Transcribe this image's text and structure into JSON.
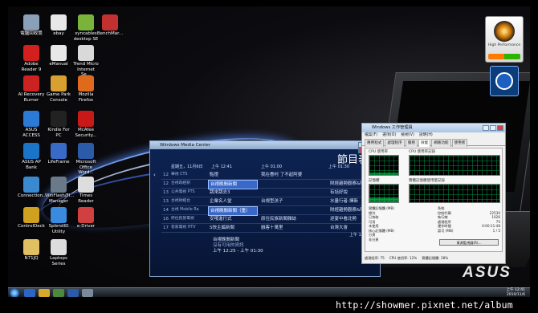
{
  "desktop_icons": [
    {
      "label": "電腦回收筒",
      "color": "#8aa0b8"
    },
    {
      "label": "ebay",
      "color": "#e8e8e8"
    },
    {
      "label": "syncables desktop SE",
      "color": "#7ab33a"
    },
    {
      "label": "BenchMar...",
      "color": "#c23030"
    },
    {
      "label": "Adobe Reader 9",
      "color": "#d41f1f"
    },
    {
      "label": "eManual",
      "color": "#e8e8e8"
    },
    {
      "label": "Trend Micro Internet Se...",
      "color": "#d9d9d9"
    },
    {
      "label": "AI Recovery Burner",
      "color": "#c22"
    },
    {
      "label": "Game Park Console",
      "color": "#d8a030"
    },
    {
      "label": "Mozilla Firefox",
      "color": "#e06a1c"
    },
    {
      "label": "ASUS ACCESS",
      "color": "#2a7ad6"
    },
    {
      "label": "Kindle For PC",
      "color": "#222"
    },
    {
      "label": "McAfee Security...",
      "color": "#c81818"
    },
    {
      "label": "ASUS AP Bank",
      "color": "#1a74c8"
    },
    {
      "label": "LifeFrame",
      "color": "#3a6ac8"
    },
    {
      "label": "Microsoft Office Word...",
      "color": "#2b5aa8"
    },
    {
      "label": "Connection...",
      "color": "#3a8ad0"
    },
    {
      "label": "WinFlash/Fl... Manager",
      "color": "#6a7a8a"
    },
    {
      "label": "Times Reader",
      "color": "#ddd"
    },
    {
      "label": "ControlDeck",
      "color": "#d0a020"
    },
    {
      "label": "SplendID Utility",
      "color": "#3a8ae0"
    },
    {
      "label": "e-Driver",
      "color": "#d04040"
    },
    {
      "label": "N71JQ",
      "color": "#e0c060"
    },
    {
      "label": "Laptops Series",
      "color": "#ddd"
    }
  ],
  "gadget": {
    "label": "High Performance"
  },
  "wmc": {
    "window_title": "Windows Media Center",
    "heading": "節目表",
    "date_label": "星期五，11月6日",
    "times": [
      "上午 12:00",
      "上午 12:41",
      "上午 01:00",
      "上午 01:30"
    ],
    "rows": [
      {
        "num": "12",
        "channel": "華視 CTS",
        "cells": [
          "點燈",
          "我在眷村 了不起阿婆",
          ""
        ]
      },
      {
        "num": "12",
        "channel": "台視政經新",
        "cells": [
          "台視晚間新聞",
          "",
          "財經趨勢觀察&財經後市趨勢"
        ]
      },
      {
        "num": "13",
        "channel": "公共電視 PTS",
        "cells": [
          "跳來跳去3",
          "",
          "有話好說"
        ]
      },
      {
        "num": "13",
        "channel": "台視財經台",
        "cells": [
          "企業名人堂",
          "台視型孩子",
          "水量行者-擇新"
        ]
      },
      {
        "num": "14",
        "channel": "台視 Mobile Ra",
        "cells": [
          "台視晚間新聞（重）",
          "",
          "財經趨勢觀察&財經後市趨勢"
        ]
      },
      {
        "num": "16",
        "channel": "原住民族電視",
        "cells": [
          "安哦進行式",
          "原住民族新聞雜誌",
          "迎宴中看北勢"
        ]
      },
      {
        "num": "17",
        "channel": "客家電視 HTV",
        "cells": [
          "S快主編新聞",
          "融客十萬里",
          "台灣大會"
        ]
      }
    ],
    "clock": "上午 12:41",
    "detail_title": "台視晚間新聞",
    "detail_sub": "沒有可用的資訊",
    "detail_time": "上午 12:25 - 上午 01:30"
  },
  "task_manager": {
    "window_title": "Windows 工作管理員",
    "menu": [
      "檔案(F)",
      "選項(O)",
      "檢視(V)",
      "說明(H)"
    ],
    "tabs": [
      "應用程式",
      "處理程序",
      "服務",
      "效能",
      "網路功能",
      "使用者"
    ],
    "active_tab": "效能",
    "labels": [
      "CPU 使用率",
      "CPU 使用率記錄",
      "記憶體",
      "實體記憶體使用量記錄"
    ],
    "cpu_usage": 0.12,
    "memory_usage": 0.28,
    "stats_left": [
      "實體記憶體 (MB)",
      "總共",
      "已快取",
      "可用",
      "未使用",
      "核心記憶體 (MB)",
      "分頁",
      "非分頁"
    ],
    "stats_left_values": [
      "",
      "",
      "",
      "",
      "",
      "",
      "",
      ""
    ],
    "stats_right": [
      "系統",
      "控制代碼",
      "執行緒",
      "處理程序",
      "運作時間",
      "認可 (MB)"
    ],
    "stats_right_values": [
      "",
      "22530",
      "1026",
      "75",
      "0:00:11:48",
      "1 / 5"
    ],
    "resource_button": "資源監視器(R)...",
    "status": [
      "處理程序: 75",
      "CPU 使用率: 12%",
      "實體記憶體: 28%"
    ]
  },
  "taskbar": {
    "tray_time": "上午 12:41",
    "tray_date": "2010/11/6"
  },
  "watermark": "http://showmer.pixnet.net/album",
  "brand": "ASUS"
}
